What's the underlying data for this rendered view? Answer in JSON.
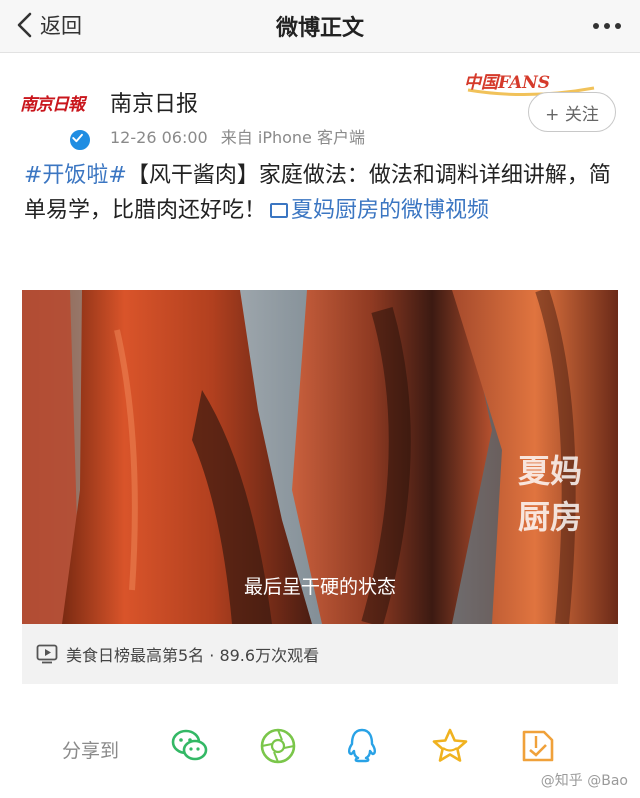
{
  "nav": {
    "back_label": "返回",
    "title": "微博正文"
  },
  "post": {
    "avatar_text": "南京日報",
    "author": "南京日报",
    "time": "12-26 06:00",
    "source": "来自 iPhone 客户端",
    "fans_badge": "中国FANS",
    "follow_label": "+ 关注",
    "text": {
      "hashtag": "#开饭啦#",
      "body": "【风干酱肉】家庭做法：做法和调料详细讲解，简单易学，比腊肉还好吃！",
      "link": "夏妈厨房的微博视频"
    },
    "video": {
      "subtitle": "最后呈干硬的状态",
      "watermark_line1": "夏妈",
      "watermark_line2": "厨房"
    },
    "stats": "美食日榜最高第5名 · 89.6万次观看"
  },
  "share": {
    "label": "分享到",
    "targets": [
      "wechat-icon",
      "moments-icon",
      "qq-icon",
      "favorite-icon",
      "save-icon"
    ]
  },
  "watermark": "@知乎 @Bao"
}
